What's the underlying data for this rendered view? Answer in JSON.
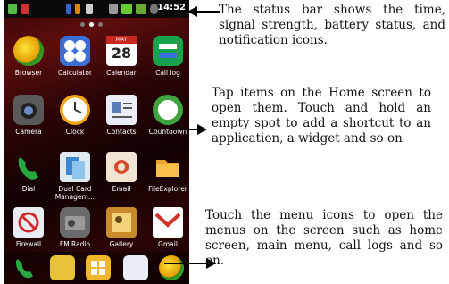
{
  "status_bar": {
    "time": "14:52"
  },
  "apps": [
    {
      "label": "Browser",
      "icon": "browser-icon"
    },
    {
      "label": "Calculator",
      "icon": "calculator-icon"
    },
    {
      "label": "Calendar",
      "icon": "calendar-icon",
      "icon_text": "28",
      "icon_header": "MAY"
    },
    {
      "label": "Call log",
      "icon": "call-log-icon"
    },
    {
      "label": "Camera",
      "icon": "camera-icon"
    },
    {
      "label": "Clock",
      "icon": "clock-icon"
    },
    {
      "label": "Contacts",
      "icon": "contacts-icon"
    },
    {
      "label": "Countdown",
      "icon": "countdown-icon"
    },
    {
      "label": "Dial",
      "icon": "dial-icon"
    },
    {
      "label": "Dual Card Managem…",
      "icon": "dual-card-icon"
    },
    {
      "label": "Email",
      "icon": "email-icon"
    },
    {
      "label": "FileExplorer",
      "icon": "folder-icon"
    },
    {
      "label": "Firewall",
      "icon": "firewall-icon"
    },
    {
      "label": "FM Radio",
      "icon": "radio-icon"
    },
    {
      "label": "Gallery",
      "icon": "gallery-icon"
    },
    {
      "label": "Gmail",
      "icon": "gmail-icon"
    }
  ],
  "dock": [
    "phone-icon",
    "messaging-icon",
    "menu-icon",
    "contacts-icon",
    "browser-icon"
  ],
  "callouts": {
    "status": "The status bar shows the time, signal strength, battery status, and notification icons.",
    "home": "Tap items on the Home screen to open them. Touch and hold an empty spot to add a shortcut to an application, a widget and so on",
    "menu": "Touch the menu icons to open the menus on the screen such as home screen, main menu, call logs and so on."
  },
  "colors": {
    "phone_bg": "#2a0406",
    "text": "#111111"
  }
}
